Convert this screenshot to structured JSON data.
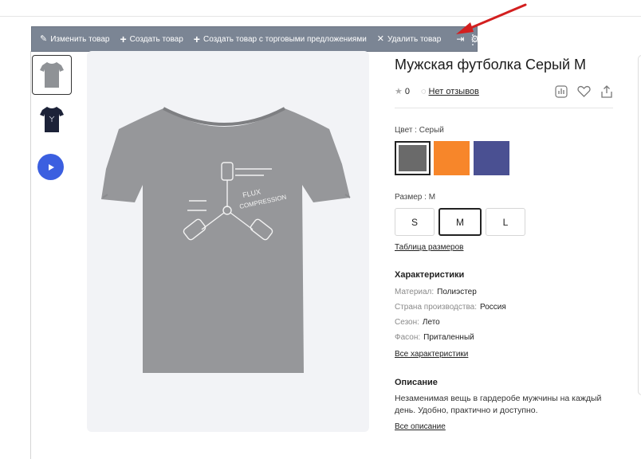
{
  "toolbar": {
    "edit_label": "Изменить товар",
    "create_label": "Создать товар",
    "create_offers_label": "Создать товар с торговыми предложениями",
    "delete_label": "Удалить товар"
  },
  "product": {
    "title": "Мужская футболка Серый M",
    "rating": "0",
    "reviews": "Нет отзывов",
    "color_label": "Цвет : Серый",
    "colors": [
      "#6a6a6a",
      "#f7862a",
      "#4a5092"
    ],
    "size_label": "Размер : M",
    "sizes": [
      "S",
      "M",
      "L"
    ],
    "size_table_link": "Таблица размеров"
  },
  "specs": {
    "heading": "Характеристики",
    "items": [
      {
        "key": "Материал:",
        "value": "Полиэстер"
      },
      {
        "key": "Страна производства:",
        "value": "Россия"
      },
      {
        "key": "Сезон:",
        "value": "Лето"
      },
      {
        "key": "Фасон:",
        "value": "Приталенный"
      }
    ],
    "all_link": "Все характеристики"
  },
  "description": {
    "heading": "Описание",
    "text": "Незаменимая вещь в гардеробе мужчины на каждый день. Удобно, практично и доступно.",
    "all_link": "Все описание"
  },
  "tshirt_print": {
    "line1": "FLUX",
    "line2": "COMPRESSION"
  },
  "icons": [
    "pencil-icon",
    "plus-icon",
    "close-icon",
    "pin-icon",
    "gear-icon",
    "chevron-down-icon",
    "star-icon",
    "comment-icon",
    "compare-icon",
    "heart-icon",
    "share-icon",
    "play-icon"
  ],
  "accent": "#3b5fe0",
  "annotation_arrow_color": "#d31f1f"
}
